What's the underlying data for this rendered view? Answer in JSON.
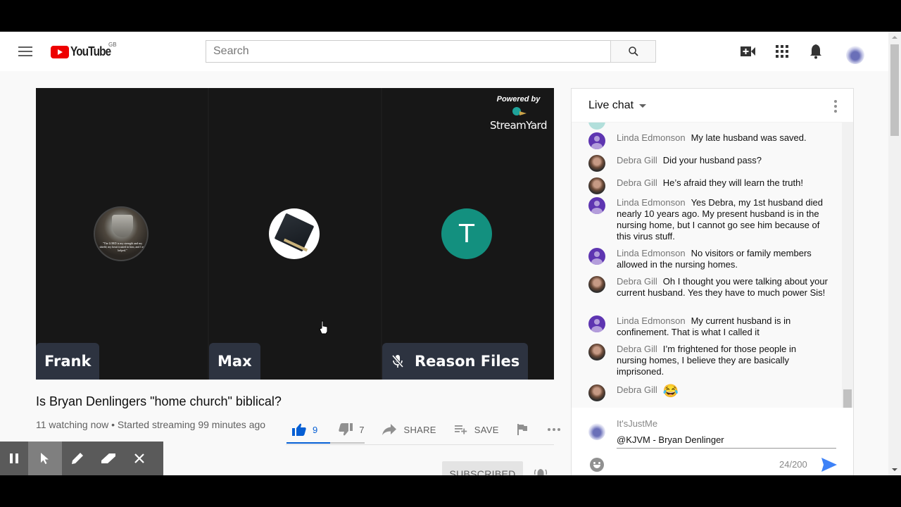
{
  "masthead": {
    "logo_text": "YouTube",
    "region": "GB",
    "search_placeholder": "Search",
    "icons": [
      "hamburger-menu-icon",
      "search-icon",
      "create-video-icon",
      "apps-grid-icon",
      "notifications-bell-icon",
      "account-avatar"
    ]
  },
  "player": {
    "participants": [
      {
        "name": "Frank",
        "avatar": "shield-image",
        "avatar_caption": "\"The LORD is my strength and my shield; my heart trusted in him, and I am helped.\"",
        "muted": false
      },
      {
        "name": "Max",
        "avatar": "bible-image",
        "muted": false
      },
      {
        "name": "Reason Files",
        "avatar_letter": "T",
        "muted": true
      }
    ],
    "powered_by": "Powered by",
    "brand": "StreamYard",
    "accent_teal": "#13907f"
  },
  "video": {
    "title": "Is Bryan Denlingers \"home church\" biblical?",
    "meta": "11 watching now • Started streaming 99 minutes ago",
    "likes": "9",
    "dislikes": "7",
    "like_ratio": 0.56,
    "share_label": "SHARE",
    "save_label": "SAVE",
    "subscribe_label": "SUBSCRIBED",
    "accent_blue": "#065fd4"
  },
  "annotation_toolbar": {
    "tools": [
      "pause",
      "pointer",
      "pen",
      "eraser",
      "close"
    ],
    "active": "pointer"
  },
  "chat": {
    "title": "Live chat",
    "messages": [
      {
        "author": "Linda Edmonson",
        "text": "My late husband was saved.",
        "avatar": "purple"
      },
      {
        "author": "Debra Gill",
        "text": "Did your husband pass?",
        "avatar": "photo"
      },
      {
        "author": "Debra Gill",
        "text": "He’s afraid they will learn the truth!",
        "avatar": "photo"
      },
      {
        "author": "Linda Edmonson",
        "text": "Yes Debra, my 1st husband died nearly 10 years ago. My present husband is in the nursing home, but I cannot go see him because of this virus stuff.",
        "avatar": "purple"
      },
      {
        "author": "Linda Edmonson",
        "text": "No visitors or family members allowed in the nursing homes.",
        "avatar": "purple"
      },
      {
        "author": "Debra Gill",
        "text": "Oh I thought you were talking about your current husband. Yes they have to much power Sis!",
        "avatar": "photo"
      },
      {
        "author": "Linda Edmonson",
        "text": "My current husband is in confinement. That is what I called it",
        "avatar": "purple"
      },
      {
        "author": "Debra Gill",
        "text": "I’m frightened for those people in nursing homes, I believe they are basically imprisoned.",
        "avatar": "photo"
      },
      {
        "author": "Debra Gill",
        "text": "😂",
        "avatar": "photo"
      }
    ],
    "input": {
      "user": "It'sJustMe",
      "value": "@KJVM - Bryan Denlinger",
      "char_count": "24/200"
    }
  }
}
